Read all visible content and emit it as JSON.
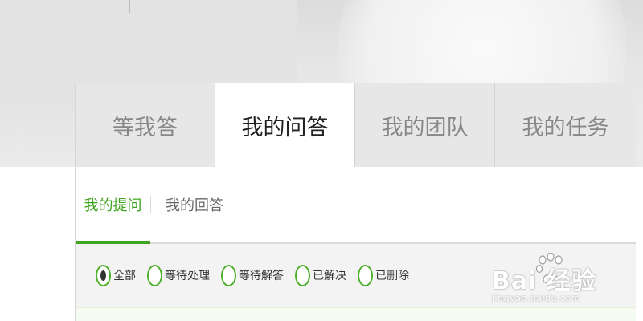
{
  "tabs": [
    {
      "label": "等我答"
    },
    {
      "label": "我的问答",
      "active": true
    },
    {
      "label": "我的团队"
    },
    {
      "label": "我的任务"
    }
  ],
  "sub_tabs": [
    {
      "label": "我的提问",
      "active": true
    },
    {
      "label": "我的回答"
    }
  ],
  "filters": [
    {
      "label": "全部",
      "selected": true
    },
    {
      "label": "等待处理"
    },
    {
      "label": "等待解答"
    },
    {
      "label": "已解决"
    },
    {
      "label": "已删除"
    }
  ],
  "watermark": {
    "main": "Bai 经验",
    "sub": "jingyan.baidu.com"
  },
  "colors": {
    "accent": "#3fa51e",
    "radio_border": "#4db02a"
  },
  "icons": {
    "watermark_logo": "paw-icon"
  }
}
